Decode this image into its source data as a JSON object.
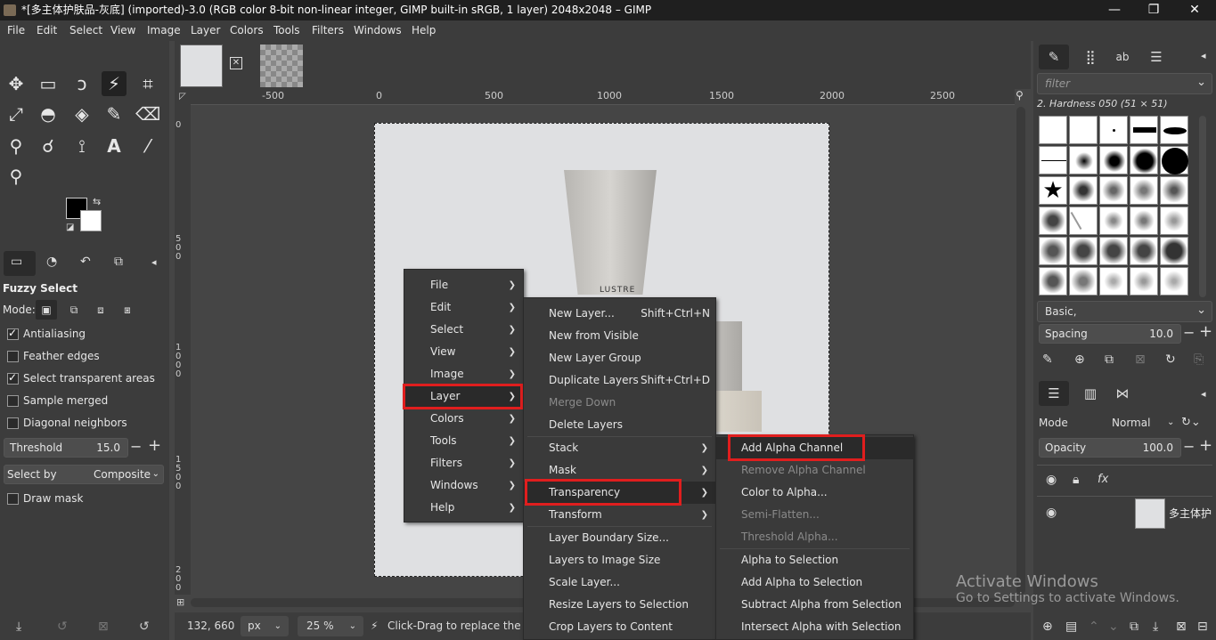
{
  "window": {
    "title": "*[多主体护肤品-灰底] (imported)-3.0 (RGB color 8-bit non-linear integer, GIMP built-in sRGB, 1 layer) 2048x2048 – GIMP",
    "minimize": "—",
    "restore": "❐",
    "close": "✕"
  },
  "menubar": [
    "File",
    "Edit",
    "Select",
    "View",
    "Image",
    "Layer",
    "Colors",
    "Tools",
    "Filters",
    "Windows",
    "Help"
  ],
  "tool_options": {
    "title": "Fuzzy Select",
    "mode_label": "Mode:",
    "antialiasing": "Antialiasing",
    "feather_edges": "Feather edges",
    "select_transparent": "Select transparent areas",
    "sample_merged": "Sample merged",
    "diagonal_neighbors": "Diagonal neighbors",
    "threshold_label": "Threshold",
    "threshold_value": "15.0",
    "select_by_label": "Select by",
    "select_by_value": "Composite",
    "draw_mask": "Draw mask"
  },
  "ruler": {
    "h_ticks": [
      "-500",
      "0",
      "500",
      "1000",
      "1500",
      "2000",
      "2500"
    ],
    "v_ticks": [
      "0",
      "5\n0\n0",
      "1\n0\n0\n0",
      "1\n5\n0\n0",
      "2\n0\n0"
    ]
  },
  "image_text": "LUSTRE",
  "status": {
    "coords": "132, 660",
    "unit": "px",
    "zoom": "25 %",
    "message": "Click-Drag to replace the cur"
  },
  "context_menu": {
    "main": [
      "File",
      "Edit",
      "Select",
      "View",
      "Image",
      "Layer",
      "Colors",
      "Tools",
      "Filters",
      "Windows",
      "Help"
    ],
    "layer": [
      {
        "label": "New Layer...",
        "acc": "Shift+Ctrl+N"
      },
      {
        "label": "New from Visible",
        "acc": ""
      },
      {
        "label": "New Layer Group",
        "acc": ""
      },
      {
        "label": "Duplicate Layers",
        "acc": "Shift+Ctrl+D"
      },
      {
        "label": "Merge Down",
        "acc": ""
      },
      {
        "label": "Delete Layers",
        "acc": ""
      },
      {
        "label": "Stack",
        "acc": ""
      },
      {
        "label": "Mask",
        "acc": ""
      },
      {
        "label": "Transparency",
        "acc": ""
      },
      {
        "label": "Transform",
        "acc": ""
      },
      {
        "label": "Layer Boundary Size...",
        "acc": ""
      },
      {
        "label": "Layers to Image Size",
        "acc": ""
      },
      {
        "label": "Scale Layer...",
        "acc": ""
      },
      {
        "label": "Resize Layers to Selection",
        "acc": ""
      },
      {
        "label": "Crop Layers to Content",
        "acc": ""
      }
    ],
    "transparency": [
      "Add Alpha Channel",
      "Remove Alpha Channel",
      "Color to Alpha...",
      "Semi-Flatten...",
      "Threshold Alpha...",
      "Alpha to Selection",
      "Add Alpha to Selection",
      "Subtract Alpha from Selection",
      "Intersect Alpha with Selection"
    ]
  },
  "brushes": {
    "filter_placeholder": "filter",
    "current": "2. Hardness 050 (51 × 51)",
    "preset": "Basic,",
    "spacing_label": "Spacing",
    "spacing_value": "10.0"
  },
  "layers": {
    "mode_label": "Mode",
    "mode_value": "Normal",
    "opacity_label": "Opacity",
    "opacity_value": "100.0",
    "layer_name": "多主体护"
  },
  "watermark": {
    "line1": "Activate Windows",
    "line2": "Go to Settings to activate Windows."
  }
}
